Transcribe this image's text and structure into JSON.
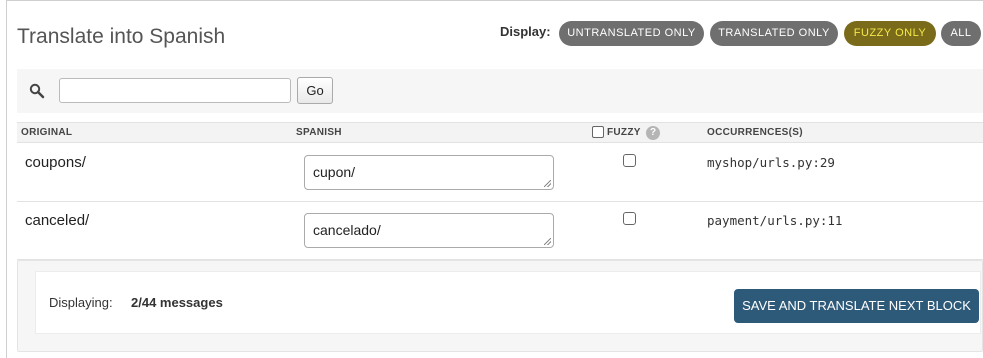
{
  "header": {
    "title": "Translate into Spanish",
    "display_label": "Display:",
    "filters": [
      {
        "label": "UNTRANSLATED ONLY",
        "active": false
      },
      {
        "label": "TRANSLATED ONLY",
        "active": false
      },
      {
        "label": "FUZZY ONLY",
        "active": true
      },
      {
        "label": "ALL",
        "active": false
      }
    ]
  },
  "search": {
    "value": "",
    "placeholder": "",
    "go_label": "Go",
    "icon": "search-icon"
  },
  "table": {
    "columns": {
      "original": "ORIGINAL",
      "spanish": "SPANISH",
      "fuzzy": "FUZZY",
      "occurrences": "OCCURRENCES(S)"
    },
    "help_symbol": "?",
    "rows": [
      {
        "original": "coupons/",
        "translation": "cupon/",
        "fuzzy": false,
        "occurrence": "myshop/urls.py:29"
      },
      {
        "original": "canceled/",
        "translation": "cancelado/",
        "fuzzy": false,
        "occurrence": "payment/urls.py:11"
      }
    ]
  },
  "footer": {
    "displaying_label": "Displaying:",
    "displaying_count": "2/44 messages",
    "save_label": "SAVE AND TRANSLATE NEXT BLOCK"
  },
  "colors": {
    "pill_bg": "#6f6f6f",
    "pill_active_bg": "#7a6b1a",
    "pill_active_text": "#f5e84a",
    "primary_button": "#2e5a79"
  }
}
